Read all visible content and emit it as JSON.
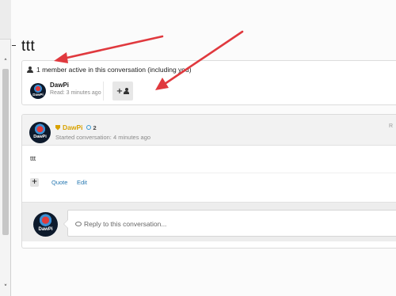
{
  "conversation": {
    "title": "ttt"
  },
  "participants": {
    "summary": "1 member active in this conversation (including you)",
    "members": [
      {
        "name": "DawPi",
        "read_status": "Read: 3 minutes ago",
        "avatar_text": "DawPi"
      }
    ],
    "invite_icon": "plus-user-icon"
  },
  "message": {
    "author": "DawPi",
    "author_color": "#d8a200",
    "reaction_count": "2",
    "started": "Started conversation: 4 minutes ago",
    "post_number": "R",
    "avatar_text": "DawPi",
    "body": "ttt",
    "actions": {
      "plus": "+",
      "quote": "Quote",
      "edit": "Edit"
    }
  },
  "reply": {
    "avatar_text": "DawPi",
    "placeholder": "Reply to this conversation..."
  },
  "scrollbar": {
    "up": "˄",
    "down": "˅"
  },
  "colors": {
    "link": "#2577b1",
    "arrow": "#e0393e",
    "highlight_name": "#d8a200"
  }
}
